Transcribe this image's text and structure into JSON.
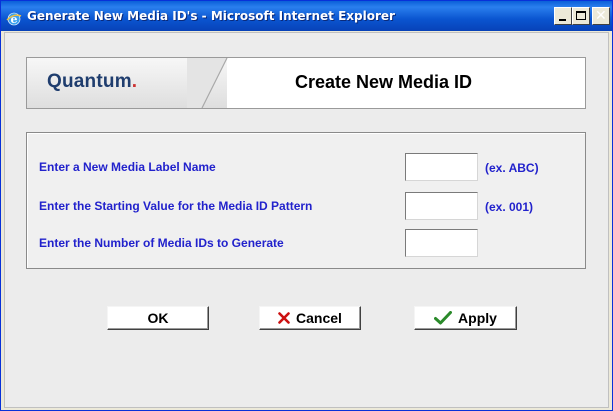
{
  "window": {
    "title": "Generate New Media ID's - Microsoft Internet Explorer",
    "icon": "ie-icon",
    "controls": [
      "minimize",
      "maximize",
      "close"
    ]
  },
  "header": {
    "logo_text": "Quantum",
    "logo_dot": ".",
    "title": "Create New Media ID"
  },
  "form": {
    "rows": [
      {
        "label": "Enter a New Media Label Name",
        "value": "",
        "example": "(ex. ABC)"
      },
      {
        "label": "Enter the Starting Value for the Media ID Pattern",
        "value": "",
        "example": "(ex. 001)"
      },
      {
        "label": "Enter the Number of Media IDs to Generate",
        "value": "",
        "example": ""
      }
    ]
  },
  "buttons": {
    "ok": "OK",
    "cancel": "Cancel",
    "apply": "Apply"
  },
  "colors": {
    "label_blue": "#2222cc",
    "titlebar_blue": "#0a55d0",
    "cancel_x_red": "#cc1111",
    "apply_check_green": "#2a8a2a"
  }
}
